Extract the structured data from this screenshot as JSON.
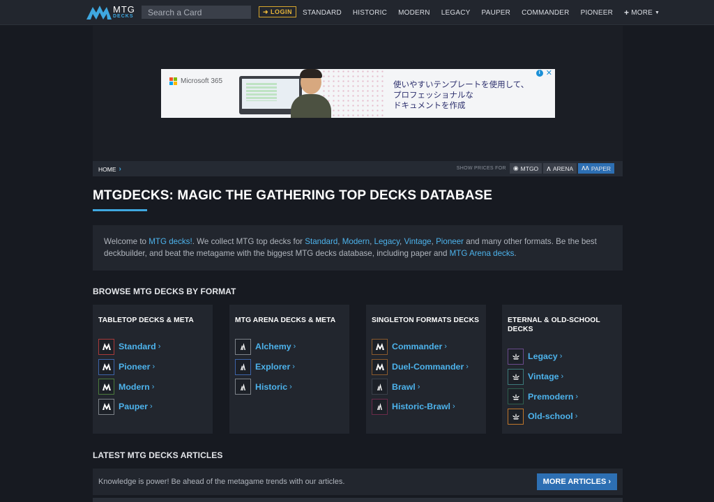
{
  "header": {
    "logo": {
      "line1": "MTG",
      "line2": "DECKS",
      "icon": "mtgdecks-logo-icon"
    },
    "search": {
      "placeholder": "Search a Card"
    },
    "login_label": "LOGIN",
    "nav": [
      "STANDARD",
      "HISTORIC",
      "MODERN",
      "LEGACY",
      "PAUPER",
      "COMMANDER",
      "PIONEER"
    ],
    "more_label": "MORE"
  },
  "ad": {
    "brand": "Microsoft 365",
    "lines": [
      "使いやすいテンプレートを使用して、",
      "プロフェッショナルな",
      "ドキュメントを作成"
    ]
  },
  "breadcrumb": {
    "home": "HOME",
    "show_prices_label": "SHOW PRICES FOR",
    "price_options": [
      {
        "label": "MTGO",
        "active": false
      },
      {
        "label": "ARENA",
        "active": false
      },
      {
        "label": "PAPER",
        "active": true
      }
    ]
  },
  "page_title": "MTGDECKS: MAGIC THE GATHERING TOP DECKS DATABASE",
  "intro": {
    "t1": "Welcome to ",
    "l1": "MTG decks!",
    "t2": ". We collect MTG top decks for ",
    "l2": "Standard",
    "c1": ", ",
    "l3": "Modern",
    "c2": ", ",
    "l4": "Legacy",
    "c3": ", ",
    "l5": "Vintage",
    "c4": ", ",
    "l6": "Pioneer",
    "t3": " and many other formats. Be the best deckbuilder, and beat the metagame with the biggest MTG decks database, including paper and ",
    "l7": "MTG Arena decks",
    "t4": "."
  },
  "browse_heading": "BROWSE MTG DECKS BY FORMAT",
  "cards": [
    {
      "title": "TABLETOP DECKS & META",
      "items": [
        {
          "label": "Standard",
          "color": "#a93a3a",
          "icon": "mtg-icon"
        },
        {
          "label": "Pioneer",
          "color": "#3d64a8",
          "icon": "mtg-icon"
        },
        {
          "label": "Modern",
          "color": "#4b7a3c",
          "icon": "mtg-icon"
        },
        {
          "label": "Pauper",
          "color": "#7d8289",
          "icon": "mtg-icon"
        }
      ]
    },
    {
      "title": "MTG ARENA DECKS & META",
      "items": [
        {
          "label": "Alchemy",
          "color": "#7d8289",
          "icon": "arena-icon"
        },
        {
          "label": "Explorer",
          "color": "#3d64a8",
          "icon": "arena-icon"
        },
        {
          "label": "Historic",
          "color": "#7d8289",
          "icon": "arena-icon"
        }
      ]
    },
    {
      "title": "SINGLETON FORMATS DECKS",
      "items": [
        {
          "label": "Commander",
          "color": "#8a5a2e",
          "icon": "mtg-icon"
        },
        {
          "label": "Duel-Commander",
          "color": "#8a5a2e",
          "icon": "mtg-icon"
        },
        {
          "label": "Brawl",
          "color": "#3a3f49",
          "icon": "arena-icon"
        },
        {
          "label": "Historic-Brawl",
          "color": "#6b2b4a",
          "icon": "arena-icon"
        }
      ]
    },
    {
      "title": "ETERNAL & OLD-SCHOOL DECKS",
      "items": [
        {
          "label": "Legacy",
          "color": "#6a4a8c",
          "icon": "lotus-icon"
        },
        {
          "label": "Vintage",
          "color": "#3c7a7a",
          "icon": "lotus-icon"
        },
        {
          "label": "Premodern",
          "color": "#2e5e4e",
          "icon": "lotus-icon"
        },
        {
          "label": "Old-school",
          "color": "#c0762a",
          "icon": "lotus-icon"
        }
      ]
    }
  ],
  "articles_heading": "LATEST MTG DECKS ARTICLES",
  "articles": {
    "text": "Knowledge is power! Be ahead of the metagame trends with our articles.",
    "more_label": "MORE ARTICLES"
  },
  "colors": {
    "accent": "#3fa8e0",
    "link": "#4db3ec",
    "login": "#e8b63a",
    "active_button": "#2d6fb3"
  }
}
